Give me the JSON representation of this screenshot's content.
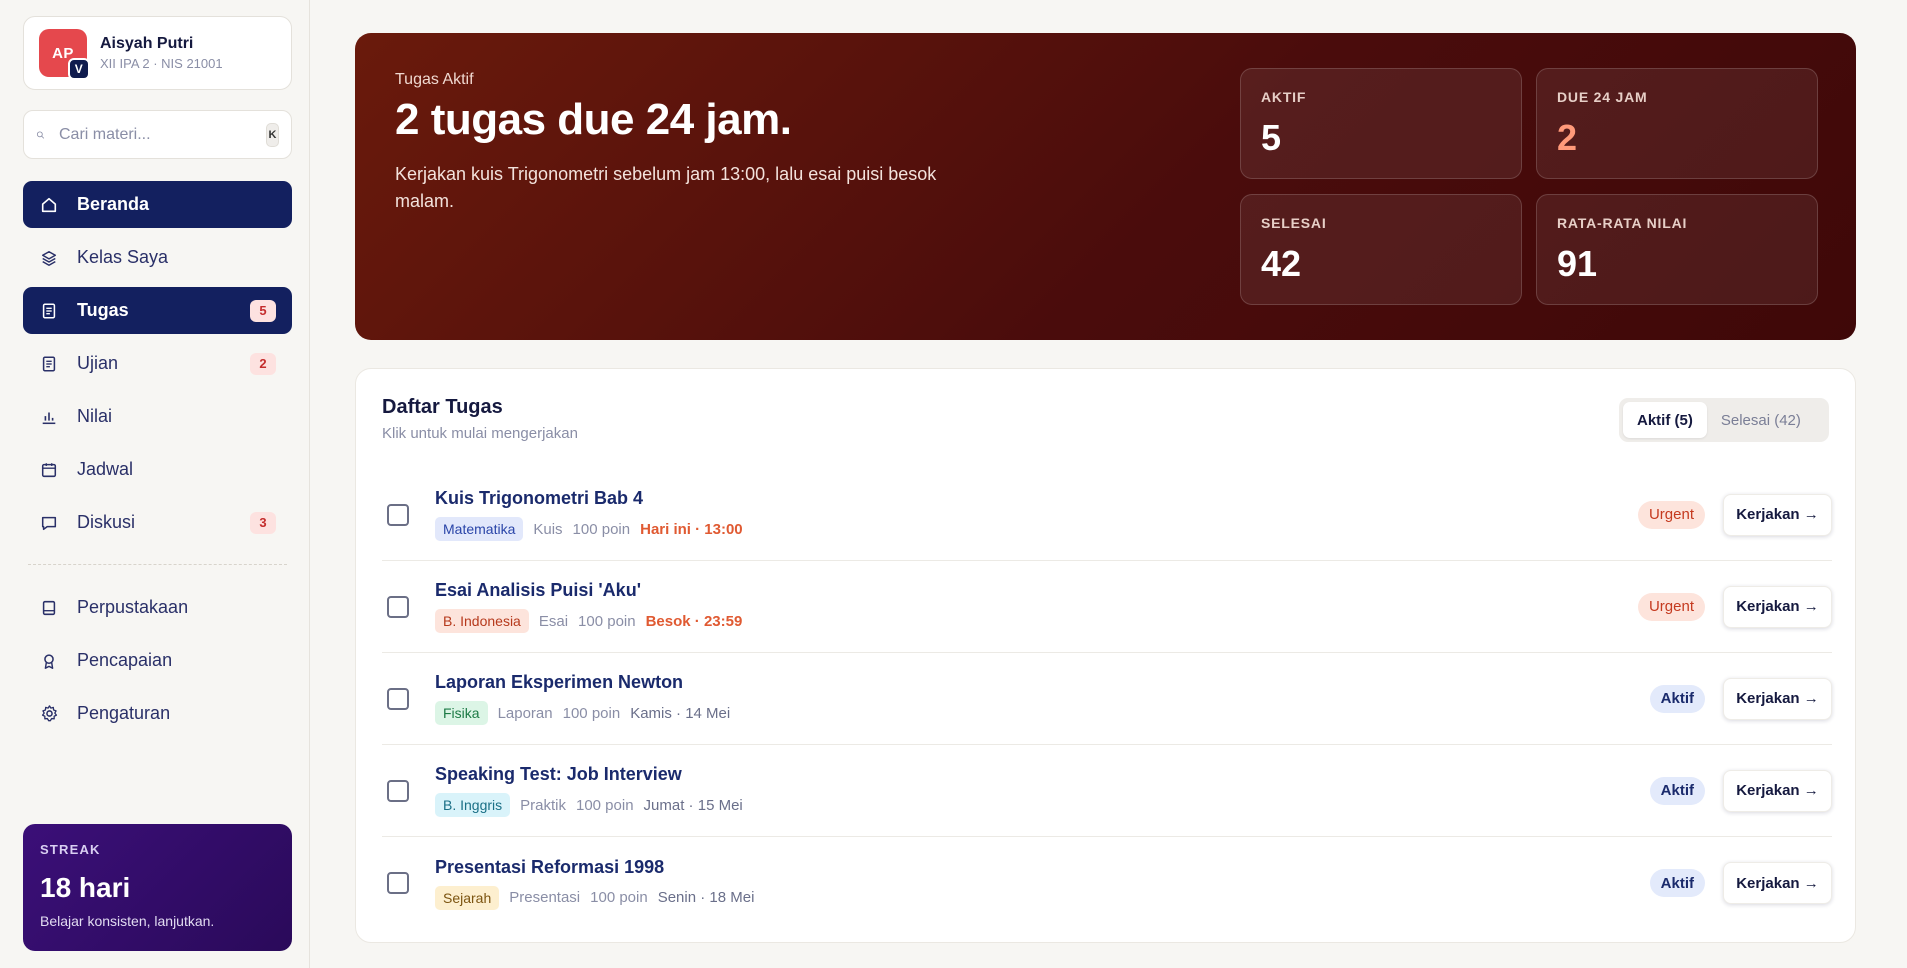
{
  "profile": {
    "initials": "AP",
    "badge": "V",
    "name": "Aisyah Putri",
    "sub": "XII IPA 2 · NIS 21001"
  },
  "search": {
    "placeholder": "Cari materi...",
    "shortcut": "K"
  },
  "nav": {
    "primary": [
      {
        "label": "Beranda",
        "icon": "home-icon",
        "active": true,
        "badge": ""
      },
      {
        "label": "Kelas Saya",
        "icon": "layers-icon",
        "active": false,
        "badge": ""
      },
      {
        "label": "Tugas",
        "icon": "document-icon",
        "active": true,
        "badge": "5"
      },
      {
        "label": "Ujian",
        "icon": "document-icon",
        "active": false,
        "badge": "2"
      },
      {
        "label": "Nilai",
        "icon": "bar-chart-icon",
        "active": false,
        "badge": ""
      },
      {
        "label": "Jadwal",
        "icon": "calendar-icon",
        "active": false,
        "badge": ""
      },
      {
        "label": "Diskusi",
        "icon": "chat-icon",
        "active": false,
        "badge": "3"
      }
    ],
    "secondary": [
      {
        "label": "Perpustakaan",
        "icon": "book-icon"
      },
      {
        "label": "Pencapaian",
        "icon": "award-icon"
      },
      {
        "label": "Pengaturan",
        "icon": "gear-icon"
      }
    ]
  },
  "streak": {
    "label": "STREAK",
    "value": "18 hari",
    "sub": "Belajar konsisten, lanjutkan."
  },
  "hero": {
    "eyebrow": "Tugas Aktif",
    "title": "2 tugas due 24 jam.",
    "desc": "Kerjakan kuis Trigonometri sebelum jam 13:00, lalu esai puisi besok malam.",
    "stats": [
      {
        "label": "AKTIF",
        "value": "5",
        "accent": false
      },
      {
        "label": "DUE 24 JAM",
        "value": "2",
        "accent": true
      },
      {
        "label": "SELESAI",
        "value": "42",
        "accent": false
      },
      {
        "label": "RATA-RATA NILAI",
        "value": "91",
        "accent": false
      }
    ]
  },
  "tasks": {
    "title": "Daftar Tugas",
    "sub": "Klik untuk mulai mengerjakan",
    "tabs": [
      {
        "label": "Aktif (5)",
        "on": true
      },
      {
        "label": "Selesai (42)",
        "on": false
      }
    ],
    "action_label": "Kerjakan →",
    "items": [
      {
        "title": "Kuis Trigonometri Bab 4",
        "subject": "Matematika",
        "subject_bg": "#e2e8fb",
        "subject_fg": "#2a45a8",
        "type": "Kuis",
        "points": "100 poin",
        "due": "Hari ini · 13:00",
        "urgent": true,
        "status": "Urgent"
      },
      {
        "title": "Esai Analisis Puisi 'Aku'",
        "subject": "B. Indonesia",
        "subject_bg": "#fde4dc",
        "subject_fg": "#b6391c",
        "type": "Esai",
        "points": "100 poin",
        "due": "Besok · 23:59",
        "urgent": true,
        "status": "Urgent"
      },
      {
        "title": "Laporan Eksperimen Newton",
        "subject": "Fisika",
        "subject_bg": "#dcf5e6",
        "subject_fg": "#1c7a45",
        "type": "Laporan",
        "points": "100 poin",
        "due": "Kamis · 14 Mei",
        "urgent": false,
        "status": "Aktif"
      },
      {
        "title": "Speaking Test: Job Interview",
        "subject": "B. Inggris",
        "subject_bg": "#d9f3fa",
        "subject_fg": "#1a6f86",
        "type": "Praktik",
        "points": "100 poin",
        "due": "Jumat · 15 Mei",
        "urgent": false,
        "status": "Aktif"
      },
      {
        "title": "Presentasi Reformasi 1998",
        "subject": "Sejarah",
        "subject_bg": "#fdefcf",
        "subject_fg": "#7c5410",
        "type": "Presentasi",
        "points": "100 poin",
        "due": "Senin · 18 Mei",
        "urgent": false,
        "status": "Aktif"
      }
    ]
  }
}
